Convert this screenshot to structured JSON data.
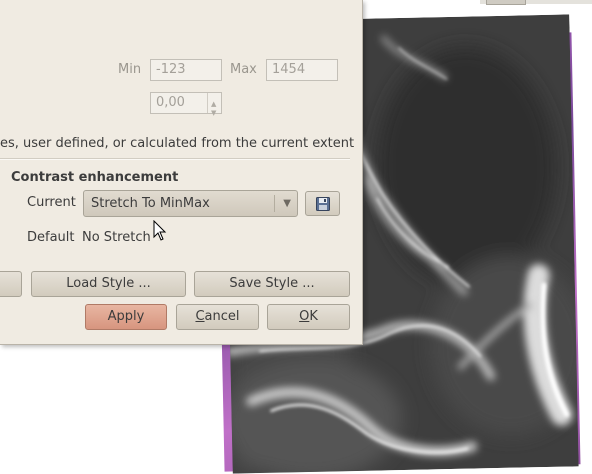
{
  "dialog": {
    "min_label": "Min",
    "min_value": "-123",
    "max_label": "Max",
    "max_value": "1454",
    "spin_value": "0,00",
    "note_text": "es, user defined, or calculated from the current extent",
    "section_title": "Contrast enhancement",
    "current_label": "Current",
    "current_value": "Stretch To MinMax",
    "default_label": "Default",
    "default_value": "No Stretch",
    "load_style_label": "Load Style ...",
    "save_style_label": "Save Style ...",
    "apply_label": "Apply",
    "cancel_label_first": "C",
    "cancel_label_rest": "ancel",
    "ok_label_first": "O",
    "ok_label_rest": "K"
  },
  "icons": {
    "save": "floppy-disk-icon",
    "dropdown": "chevron-down-icon",
    "cursor": "mouse-pointer-icon"
  },
  "colors": {
    "dialog_bg": "#f0ebe2",
    "apply_button": "#d7957f",
    "raster_border": "#b060c0"
  }
}
